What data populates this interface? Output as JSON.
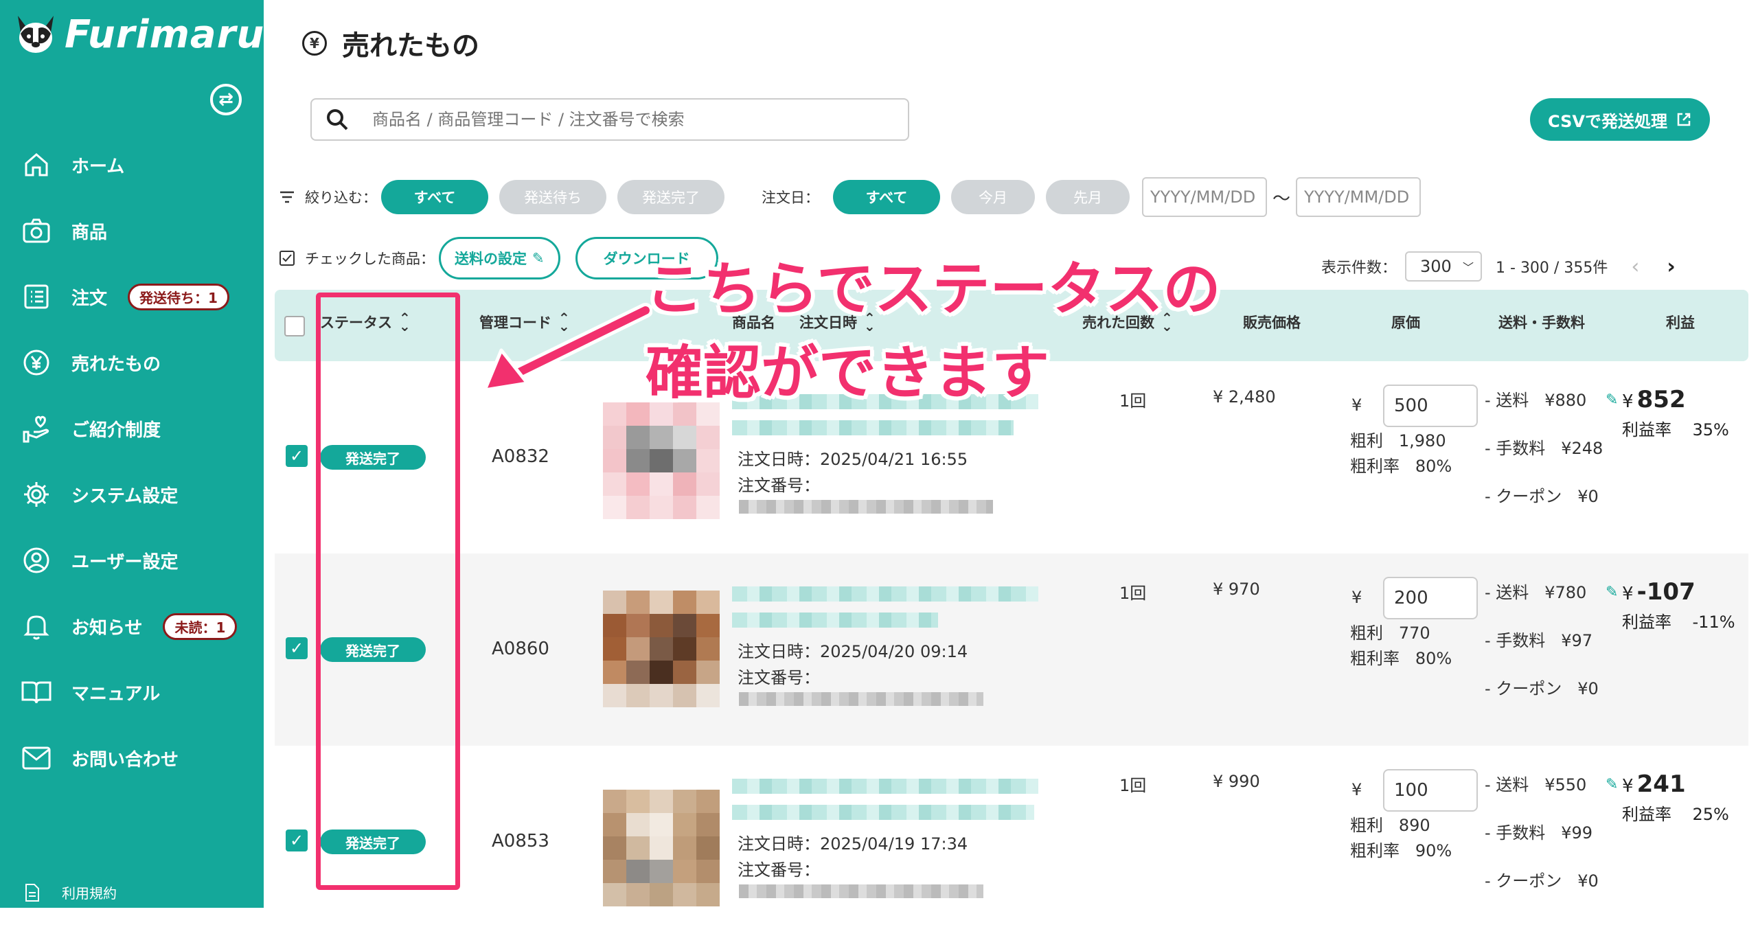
{
  "brand": {
    "name": "Furimaru?"
  },
  "sidebar": {
    "items": [
      {
        "label": "ホーム",
        "icon": "home-icon"
      },
      {
        "label": "商品",
        "icon": "camera-icon"
      },
      {
        "label": "注文",
        "icon": "list-icon",
        "badge": "発送待ち：1"
      },
      {
        "label": "売れたもの",
        "icon": "yen-icon"
      },
      {
        "label": "ご紹介制度",
        "icon": "hand-heart-icon"
      },
      {
        "label": "システム設定",
        "icon": "gear-icon"
      },
      {
        "label": "ユーザー設定",
        "icon": "user-icon"
      },
      {
        "label": "お知らせ",
        "icon": "bell-icon",
        "badge": "未読：1"
      },
      {
        "label": "マニュアル",
        "icon": "book-icon"
      },
      {
        "label": "お問い合わせ",
        "icon": "mail-icon"
      }
    ],
    "terms": "利用規約"
  },
  "page": {
    "title": "売れたもの"
  },
  "search": {
    "placeholder": "商品名 / 商品管理コード / 注文番号で検索"
  },
  "csv_button": "CSVで発送処理",
  "filters": {
    "status_label": "絞り込む：",
    "status_options": [
      "すべて",
      "発送待ち",
      "発送完了"
    ],
    "date_label": "注文日：",
    "date_options": [
      "すべて",
      "今月",
      "先月"
    ],
    "date_placeholder": "YYYY/MM/DD",
    "range_sep": "〜"
  },
  "bulk": {
    "label": "チェックした商品：",
    "shipping_button": "送料の設定",
    "download_button": "ダウンロード"
  },
  "pager": {
    "per_page_label": "表示件数：",
    "per_page_value": "300",
    "range": "1 - 300 / 355件"
  },
  "table": {
    "headers": [
      "ステータス",
      "管理コード",
      "商品名",
      "注文日時",
      "売れた回数",
      "販売価格",
      "原価",
      "送料・手数料",
      "利益"
    ],
    "order_date_prefix": "注文日時：",
    "order_no_label": "注文番号：",
    "gross_label": "粗利",
    "gross_rate_label": "粗利率",
    "profit_rate_label": "利益率",
    "yen": "¥",
    "shipping_label": "- 送料",
    "fee_label": "- 手数料",
    "coupon_label": "- クーポン",
    "rows": [
      {
        "status": "発送完了",
        "code": "A0832",
        "order_date": "2025/04/21 16:55",
        "count": "1回",
        "price": "¥ 2,480",
        "cost": "500",
        "gross": "1,980",
        "gross_rate": "80%",
        "shipping": "¥880",
        "fee": "¥248",
        "coupon": "¥0",
        "profit": "852",
        "profit_rate": "35%"
      },
      {
        "status": "発送完了",
        "code": "A0860",
        "order_date": "2025/04/20 09:14",
        "count": "1回",
        "price": "¥ 970",
        "cost": "200",
        "gross": "770",
        "gross_rate": "80%",
        "shipping": "¥780",
        "fee": "¥97",
        "coupon": "¥0",
        "profit": "-107",
        "profit_rate": "-11%"
      },
      {
        "status": "発送完了",
        "code": "A0853",
        "order_date": "2025/04/19 17:34",
        "count": "1回",
        "price": "¥ 990",
        "cost": "100",
        "gross": "890",
        "gross_rate": "90%",
        "shipping": "¥550",
        "fee": "¥99",
        "coupon": "¥0",
        "profit": "241",
        "profit_rate": "25%"
      }
    ]
  },
  "annotation": {
    "line1": "こちらでステータスの",
    "line2": "確認ができます",
    "color": "#f2306e"
  },
  "colors": {
    "accent": "#14a89a",
    "header_bg": "#d6efec"
  }
}
